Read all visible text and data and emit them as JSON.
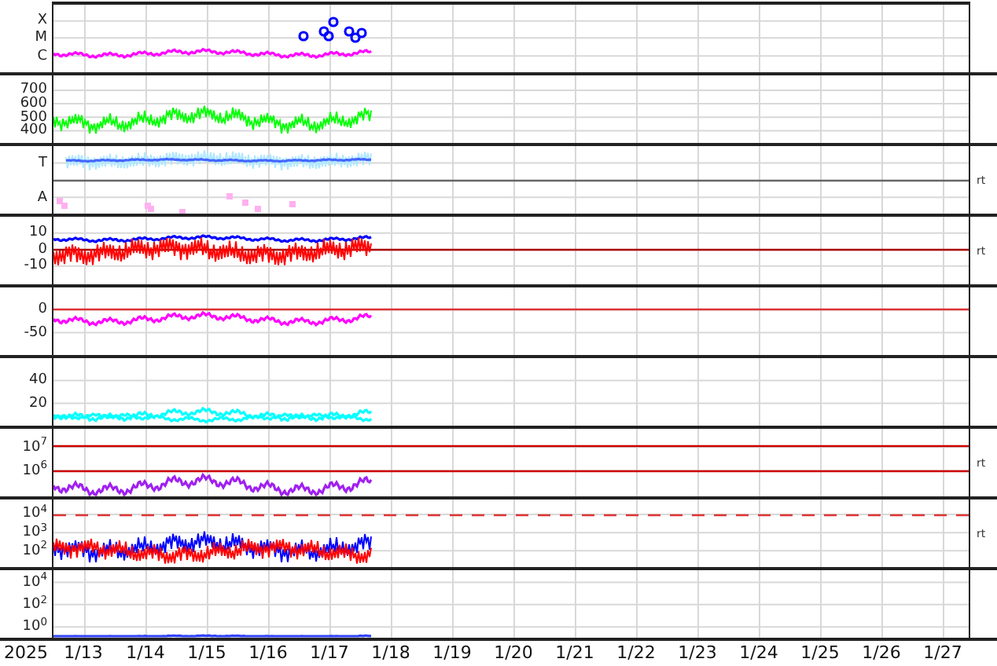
{
  "panels": [
    {
      "kind": "xray",
      "ticks": [
        "X",
        "M",
        "C"
      ],
      "traces": [
        {
          "kind": "line",
          "color": "#ff00ff"
        },
        {
          "kind": "markers",
          "color": "#0000ff"
        }
      ]
    },
    {
      "kind": "speed",
      "ticks": [
        "700",
        "600",
        "500",
        "400"
      ],
      "traces": [
        {
          "kind": "dense",
          "color": "#00ff00"
        }
      ]
    },
    {
      "kind": "temperature",
      "ticks": [
        "T",
        "A"
      ],
      "side_label": "rt",
      "traces": [
        {
          "kind": "dense",
          "color": "#b0e8ff"
        },
        {
          "kind": "line",
          "color": "#4466ff"
        },
        {
          "kind": "dots",
          "color": "#ffb0f0"
        }
      ]
    },
    {
      "kind": "field",
      "ticks": [
        "10",
        "0",
        "-10"
      ],
      "side_label": "rt",
      "traces": [
        {
          "kind": "line",
          "color": "#0000ff"
        },
        {
          "kind": "dense",
          "color": "#ff0000"
        }
      ]
    },
    {
      "kind": "index",
      "ticks": [
        "0",
        "-50"
      ],
      "traces": [
        {
          "kind": "line",
          "color": "#ff00ff"
        }
      ]
    },
    {
      "kind": "density",
      "ticks": [
        "40",
        "20"
      ],
      "traces": [
        {
          "kind": "line",
          "color": "#00ffff"
        },
        {
          "kind": "line",
          "color": "#00ffff"
        }
      ]
    },
    {
      "kind": "electron",
      "ticks": [
        "10$^{7}$",
        "10$^{6}$"
      ],
      "side_label": "rt",
      "traces": [
        {
          "kind": "line",
          "color": "#a020f0"
        }
      ]
    },
    {
      "kind": "proton",
      "ticks": [
        "10$^{4}$",
        "10$^{3}$",
        "10$^{2}$"
      ],
      "side_label": "rt",
      "traces": [
        {
          "kind": "dense",
          "color": "#0000ff"
        },
        {
          "kind": "dense",
          "color": "#ff0000"
        }
      ]
    },
    {
      "kind": "neutron",
      "ticks": [
        "10$^{4}$",
        "10$^{2}$",
        "10$^{0}$"
      ],
      "traces": [
        {
          "kind": "line",
          "color": "#3344ff"
        }
      ]
    }
  ],
  "x_axis": {
    "labels": [
      "2025",
      "1/13",
      "1/14",
      "1/15",
      "1/16",
      "1/17",
      "1/18",
      "1/19",
      "1/20",
      "1/21",
      "1/22",
      "1/23",
      "1/24",
      "1/25",
      "1/26",
      "1/27"
    ]
  }
}
